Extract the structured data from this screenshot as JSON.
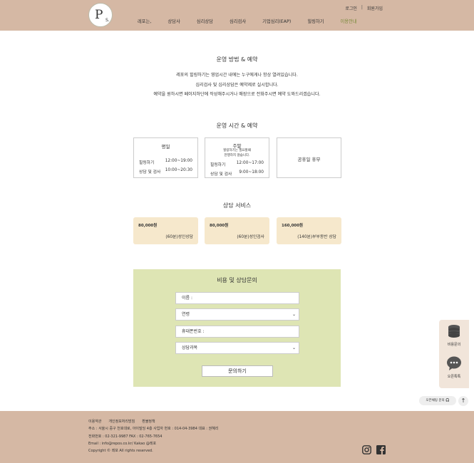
{
  "header": {
    "logo_letter": "P",
    "logo_suffix": "S.",
    "util": {
      "login": "로그인",
      "separator": "|",
      "signup": "회원가입"
    },
    "nav": [
      "레포는,",
      "상담사",
      "심리상담",
      "심리검사",
      "기업심리(EAP)",
      "힐링하기",
      "이용안내"
    ],
    "nav_active_index": 6,
    "nav_active_color": "#7a8a3a"
  },
  "operation": {
    "title": "운영 방법 & 예약",
    "lines": [
      "레포의 힐링하기는 영업시간 내에는 누구에게나 항상 열려있습니다.",
      "심리검사 및 심리상담은 예약제로 실시합니다.",
      "예약을 원하시면 페이지하단에 작성해주시거나 매장으로 전화주시면 예약 도와드리겠습니다."
    ]
  },
  "hours": {
    "title": "운영 시간 & 예약",
    "weekday": {
      "title": "평일",
      "rows": [
        {
          "label": "힐링하기",
          "value": "12:00~19:00"
        },
        {
          "label": "상담 및 검사",
          "value": "10:00~20:30"
        }
      ]
    },
    "weekend": {
      "title": "주말",
      "sub1": "힐링하기는 필요할때",
      "sub2": "찬행하지 않습니다.",
      "rows": [
        {
          "label": "힐링하기",
          "value": "12:00~17:00"
        },
        {
          "label": "상담 및 검사",
          "value": "9:00~18:00"
        }
      ]
    },
    "holiday": {
      "title": "공휴일 휴무"
    }
  },
  "services": {
    "title": "상담 서비스",
    "items": [
      {
        "price": "80,000원",
        "desc": "(60분)성인상담"
      },
      {
        "price": "80,000원",
        "desc": "(60분)성인검사"
      },
      {
        "price": "160,000원",
        "desc": "(140분)부부동반 상담"
      }
    ]
  },
  "inquiry": {
    "title": "비용 및 상담문의",
    "name_field": "이름 :",
    "age_select": "연령",
    "phone_field": "휴대폰번호 :",
    "subject_select": "상담과목",
    "submit": "문의하기",
    "bg_color": "#dee5b4"
  },
  "side": {
    "cost_label": "비용문의",
    "chat_label": "오픈톡톡",
    "kakao_pill": "오픈채팅 문의",
    "top_icon": "arrow-up-icon"
  },
  "footer": {
    "links": [
      "이용약관",
      "개인정보처리방침",
      "환불정책"
    ],
    "address": "주소 : 서울시 중구 천호대로, 아이빌딩 4층    사업자 번호 : 014-04-3984    대표 : 권혜리",
    "phone": "전화번호 : 02-321-9987     FAX : 02-765-7654",
    "email": "Email : info@repos.co.kr/      Kakao @레포",
    "copyright": "Copyright © 레포 All rights reserved.",
    "bg_color": "#d5b8a4"
  }
}
